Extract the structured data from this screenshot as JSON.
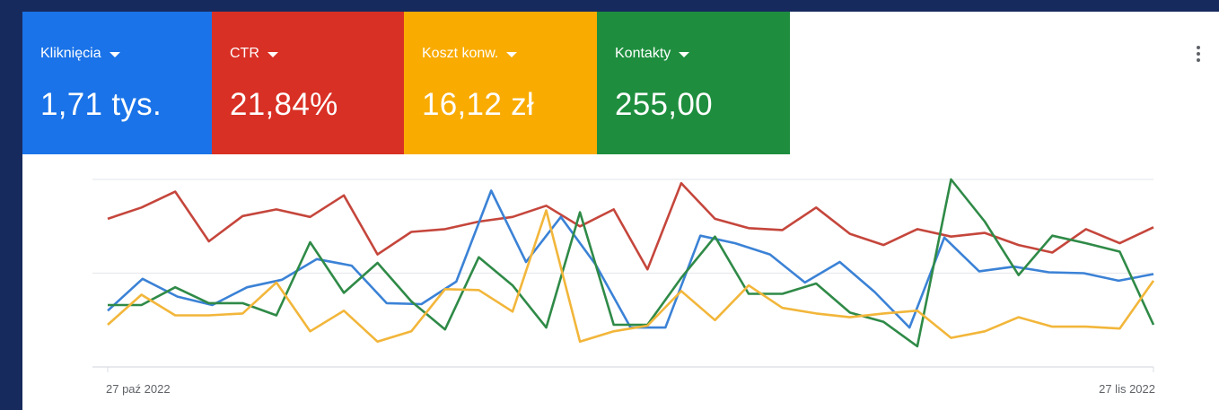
{
  "metrics": [
    {
      "label": "Kliknięcia",
      "value": "1,71 tys.",
      "color": "#1a73e8"
    },
    {
      "label": "CTR",
      "value": "21,84%",
      "color": "#d93025"
    },
    {
      "label": "Koszt konw.",
      "value": "16,12 zł",
      "color": "#f9ab00"
    },
    {
      "label": "Kontakty",
      "value": "255,00",
      "color": "#1e8e3e"
    }
  ],
  "menu_icon": "more-vert-icon",
  "chart_data": {
    "type": "line",
    "x_tick_labels": [
      "27 paź 2022",
      "27 lis 2022"
    ],
    "grid": true,
    "normalized_scale": [
      0,
      2
    ],
    "series": [
      {
        "name": "CTR",
        "color": "#c5463c",
        "values": [
          1.58,
          1.7,
          1.87,
          1.34,
          1.61,
          1.68,
          1.6,
          1.83,
          1.2,
          1.44,
          1.47,
          1.55,
          1.6,
          1.72,
          1.5,
          1.68,
          1.04,
          1.96,
          1.58,
          1.48,
          1.46,
          1.7,
          1.42,
          1.3,
          1.47,
          1.39,
          1.43,
          1.3,
          1.22,
          1.47,
          1.32,
          1.49
        ]
      },
      {
        "name": "Kliknięcia",
        "color": "#3b82d6",
        "values": [
          0.6,
          0.94,
          0.75,
          0.66,
          0.85,
          0.93,
          1.15,
          1.08,
          0.68,
          0.67,
          0.91,
          1.88,
          1.12,
          1.6,
          1.09,
          0.42,
          0.42,
          1.4,
          1.32,
          1.2,
          0.9,
          1.12,
          0.8,
          0.42,
          1.38,
          1.02,
          1.07,
          1.01,
          1.0,
          0.92,
          0.99
        ]
      },
      {
        "name": "Kontakty",
        "color": "#2f8a47",
        "values": [
          0.66,
          0.66,
          0.85,
          0.68,
          0.68,
          0.55,
          1.33,
          0.79,
          1.11,
          0.7,
          0.4,
          1.17,
          0.87,
          0.42,
          1.65,
          0.45,
          0.45,
          0.95,
          1.39,
          0.78,
          0.78,
          0.89,
          0.58,
          0.48,
          0.22,
          2.0,
          1.55,
          0.98,
          1.4,
          1.32,
          1.23,
          0.45
        ]
      },
      {
        "name": "Koszt konw.",
        "color": "#f2b63a",
        "values": [
          0.45,
          0.77,
          0.55,
          0.55,
          0.57,
          0.9,
          0.38,
          0.6,
          0.27,
          0.38,
          0.83,
          0.82,
          0.59,
          1.67,
          0.27,
          0.38,
          0.44,
          0.81,
          0.5,
          0.87,
          0.63,
          0.57,
          0.53,
          0.57,
          0.6,
          0.31,
          0.38,
          0.53,
          0.43,
          0.43,
          0.41,
          0.92
        ]
      }
    ]
  }
}
